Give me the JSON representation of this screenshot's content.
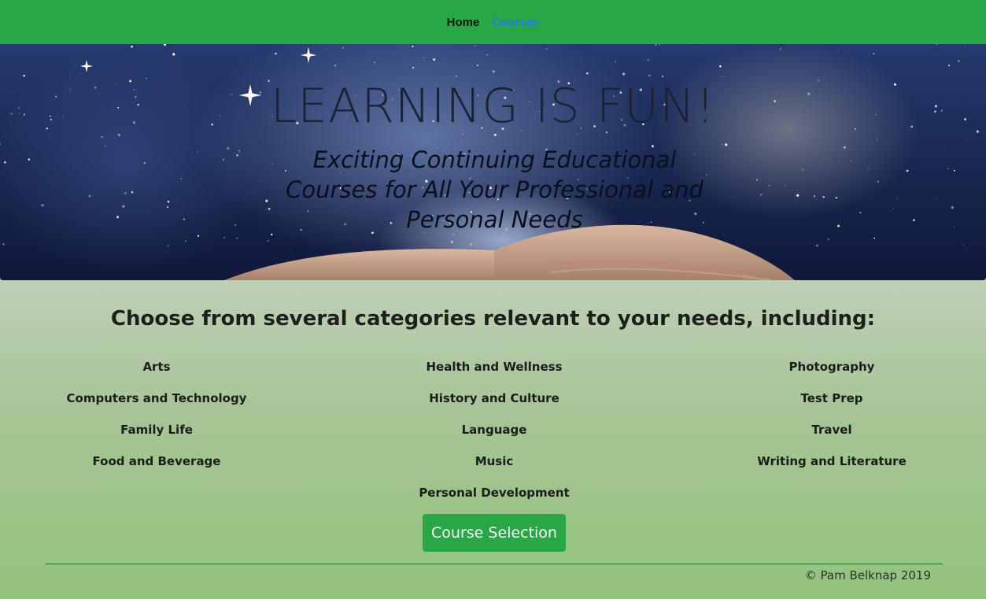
{
  "nav": {
    "home_label": "Home",
    "courses_label": "Courses"
  },
  "hero": {
    "title": "LEARNING IS FUN!",
    "subtitle": "Exciting Continuing Educational Courses for All Your Professional and Personal Needs"
  },
  "main": {
    "intro": "Choose from several categories relevant to your needs, including:",
    "categories": {
      "col1": [
        "Arts",
        "Computers and Technology",
        "Family Life",
        "Food and Beverage"
      ],
      "col2": [
        "Health and Wellness",
        "History and Culture",
        "Language",
        "Music",
        "Personal Development"
      ],
      "col3": [
        "Photography",
        "Test Prep",
        "Travel",
        "Writing and Literature"
      ]
    },
    "cta_label": "Course Selection"
  },
  "footer": {
    "copyright": "© Pam Belknap 2019"
  },
  "colors": {
    "nav_bg": "#28a745",
    "link_active": "#1d7cf0",
    "button_bg": "#28a745"
  }
}
